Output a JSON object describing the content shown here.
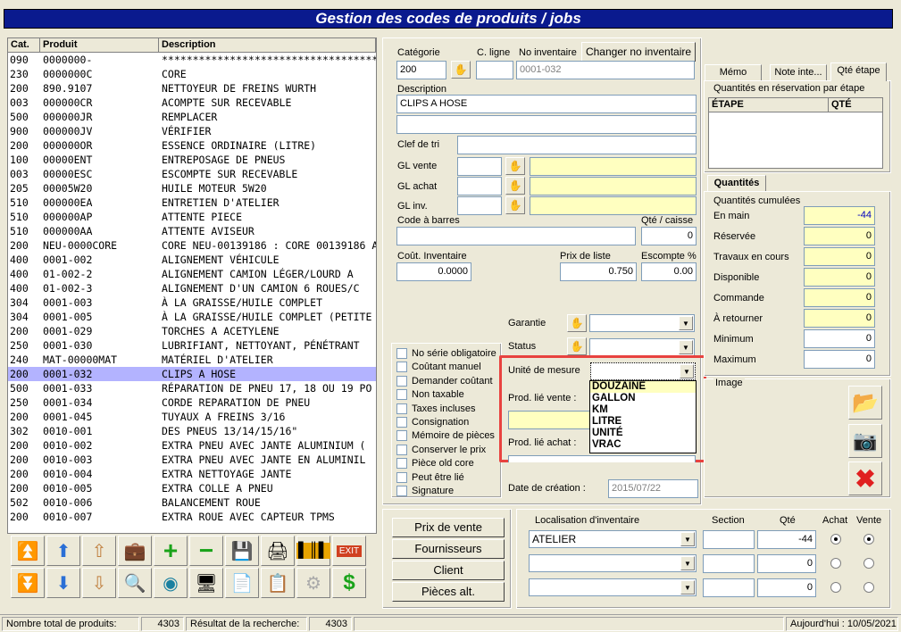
{
  "window": {
    "title": "Gestion des codes de produits / jobs"
  },
  "list": {
    "headers": [
      "Cat.",
      "Produit",
      "Description"
    ],
    "rows": [
      [
        "090",
        "0000000-",
        "**********************************************"
      ],
      [
        "230",
        "0000000C",
        "CORE"
      ],
      [
        "200",
        "890.9107",
        "NETTOYEUR DE FREINS WURTH"
      ],
      [
        "003",
        "000000CR",
        "ACOMPTE SUR RECEVABLE"
      ],
      [
        "500",
        "000000JR",
        "REMPLACER"
      ],
      [
        "900",
        "000000JV",
        "VÉRIFIER"
      ],
      [
        "200",
        "000000OR",
        "ESSENCE ORDINAIRE (LITRE)"
      ],
      [
        "100",
        "00000ENT",
        "ENTREPOSAGE DE PNEUS"
      ],
      [
        "003",
        "00000ESC",
        "ESCOMPTE SUR RECEVABLE"
      ],
      [
        "205",
        "00005W20",
        "HUILE MOTEUR 5W20"
      ],
      [
        "510",
        "000000EA",
        "ENTRETIEN D'ATELIER"
      ],
      [
        "510",
        "000000AP",
        "ATTENTE PIECE"
      ],
      [
        "510",
        "000000AA",
        "ATTENTE AVISEUR"
      ],
      [
        "200",
        "NEU-0000CORE",
        "CORE NEU-00139186 : CORE 00139186 A"
      ],
      [
        "400",
        "0001-002",
        "ALIGNEMENT VÉHICULE"
      ],
      [
        "400",
        "01-002-2",
        "ALIGNEMENT CAMION LÉGER/LOURD A"
      ],
      [
        "400",
        "01-002-3",
        "ALIGNEMENT D'UN CAMION 6 ROUES/C"
      ],
      [
        "304",
        "0001-003",
        "À LA GRAISSE/HUILE COMPLET"
      ],
      [
        "304",
        "0001-005",
        "À LA GRAISSE/HUILE COMPLET (PETITE"
      ],
      [
        "200",
        "0001-029",
        "TORCHES A ACETYLENE"
      ],
      [
        "250",
        "0001-030",
        "LUBRIFIANT, NETTOYANT, PÉNÉTRANT"
      ],
      [
        "240",
        "MAT-00000MAT",
        "MATÉRIEL D'ATELIER"
      ],
      [
        "200",
        "0001-032",
        "CLIPS A HOSE"
      ],
      [
        "500",
        "0001-033",
        "RÉPARATION DE PNEU 17, 18 OU 19 PO"
      ],
      [
        "250",
        "0001-034",
        "CORDE REPARATION DE PNEU"
      ],
      [
        "200",
        "0001-045",
        "TUYAUX A FREINS 3/16"
      ],
      [
        "302",
        "0010-001",
        "DES PNEUS 13/14/15/16\""
      ],
      [
        "200",
        "0010-002",
        "EXTRA PNEU AVEC JANTE ALUMINIUM ("
      ],
      [
        "200",
        "0010-003",
        "EXTRA PNEU AVEC JANTE EN ALUMINIL"
      ],
      [
        "200",
        "0010-004",
        "EXTRA NETTOYAGE JANTE"
      ],
      [
        "200",
        "0010-005",
        "EXTRA COLLE A PNEU"
      ],
      [
        "502",
        "0010-006",
        "BALANCEMENT ROUE"
      ],
      [
        "200",
        "0010-007",
        "EXTRA ROUE AVEC CAPTEUR TPMS"
      ]
    ],
    "selected_index": 22
  },
  "form": {
    "categorie_label": "Catégorie",
    "categorie_value": "200",
    "cligne_label": "C. ligne",
    "noinv_label": "No inventaire",
    "noinv_value": "0001-032",
    "change_noinv_label": "Changer no inventaire",
    "description_label": "Description",
    "description_value": "CLIPS A HOSE",
    "clef_label": "Clef de tri",
    "glvente_label": "GL vente",
    "glachat_label": "GL achat",
    "glinv_label": "GL inv.",
    "codebarres_label": "Code à barres",
    "qtecaisse_label": "Qté / caisse",
    "qtecaisse_value": "0",
    "cout_label": "Coût. Inventaire",
    "cout_value": "0.0000",
    "prixliste_label": "Prix de liste",
    "prixliste_value": "0.750",
    "escompte_label": "Escompte %",
    "escompte_value": "0.00",
    "garantie_label": "Garantie",
    "status_label": "Status",
    "unite_label": "Unité de mesure",
    "prodvente_label": "Prod. lié vente :",
    "prodachat_label": "Prod. lié achat :",
    "creation_label": "Date de création :",
    "creation_value": "2015/07/22",
    "unite_options": [
      "DOUZAINE",
      "GALLON",
      "KM",
      "LITRE",
      "UNITÉ",
      "VRAC"
    ]
  },
  "checkboxes": [
    "No série obligatoire",
    "Coûtant manuel",
    "Demander coûtant",
    "Non taxable",
    "Taxes incluses",
    "Consignation",
    "Mémoire de pièces",
    "Conserver le prix",
    "Pièce old core",
    "Peut être lié",
    "Signature"
  ],
  "tabs": {
    "items": [
      "Mémo",
      "Note inte...",
      "Qté étape"
    ],
    "group_label": "Quantités en réservation par étape",
    "col_etape": "ÉTAPE",
    "col_qte": "QTÉ"
  },
  "quantites": {
    "tab": "Quantités",
    "group": "Quantités cumulées",
    "rows": [
      {
        "label": "En main",
        "value": "-44"
      },
      {
        "label": "Réservée",
        "value": "0"
      },
      {
        "label": "Travaux en cours",
        "value": "0"
      },
      {
        "label": "Disponible",
        "value": "0"
      },
      {
        "label": "Commande",
        "value": "0"
      },
      {
        "label": "À retourner",
        "value": "0"
      },
      {
        "label": "Minimum",
        "value": "0"
      },
      {
        "label": "Maximum",
        "value": "0"
      }
    ]
  },
  "image_label": "Image",
  "bottom_buttons": [
    "Prix de vente",
    "Fournisseurs",
    "Client",
    "Pièces alt."
  ],
  "localisation": {
    "headers": [
      "Localisation d'inventaire",
      "Section",
      "Qté",
      "Achat",
      "Vente"
    ],
    "rows": [
      {
        "loc": "ATELIER",
        "qte": "-44"
      },
      {
        "loc": "",
        "qte": "0"
      },
      {
        "loc": "",
        "qte": "0"
      }
    ]
  },
  "status": {
    "total_label": "Nombre total de produits:",
    "total_value": "4303",
    "result_label": "Résultat de la recherche:",
    "result_value": "4303",
    "today": "Aujourd'hui : 10/05/2021"
  },
  "colors": {
    "title_bg": "#0a1a8e",
    "selected_row": "#b3b3ff",
    "yellow_field": "#ffffc0",
    "highlight_box": "#e8423f"
  }
}
